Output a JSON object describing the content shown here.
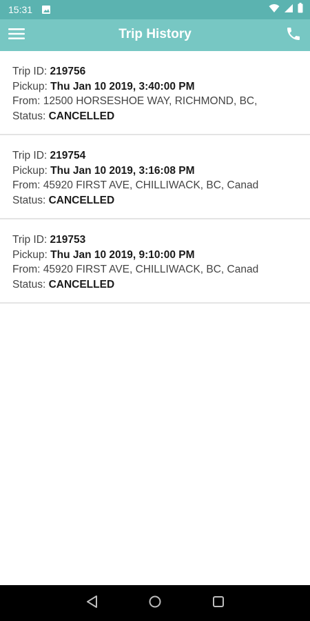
{
  "status_bar": {
    "time": "15:31",
    "icons": [
      "image-notification-icon",
      "wifi-icon",
      "signal-icon",
      "battery-icon"
    ]
  },
  "app_bar": {
    "title": "Trip History",
    "menu_icon": "hamburger-menu-icon",
    "action_icon": "phone-icon"
  },
  "trips": [
    {
      "trip_id_label": "Trip ID:",
      "trip_id": "219756",
      "pickup_label": "Pickup:",
      "pickup": "Thu Jan 10 2019, 3:40:00 PM",
      "from_label": "From:",
      "from": "12500 HORSESHOE WAY, RICHMOND, BC,",
      "status_label": "Status:",
      "status": "CANCELLED"
    },
    {
      "trip_id_label": "Trip ID:",
      "trip_id": "219754",
      "pickup_label": "Pickup:",
      "pickup": "Thu Jan 10 2019, 3:16:08 PM",
      "from_label": "From:",
      "from": "45920 FIRST AVE, CHILLIWACK, BC, Canad",
      "status_label": "Status:",
      "status": "CANCELLED"
    },
    {
      "trip_id_label": "Trip ID:",
      "trip_id": "219753",
      "pickup_label": "Pickup:",
      "pickup": "Thu Jan 10 2019, 9:10:00 PM",
      "from_label": "From:",
      "from": "45920 FIRST AVE, CHILLIWACK, BC, Canad",
      "status_label": "Status:",
      "status": "CANCELLED"
    }
  ],
  "nav_bar": {
    "icons": [
      "back-icon",
      "home-icon",
      "recents-icon"
    ]
  },
  "colors": {
    "status_bar": "#5bb3b0",
    "app_bar": "#77c7c3",
    "divider": "#e4e4e4",
    "nav_bar": "#000000"
  }
}
